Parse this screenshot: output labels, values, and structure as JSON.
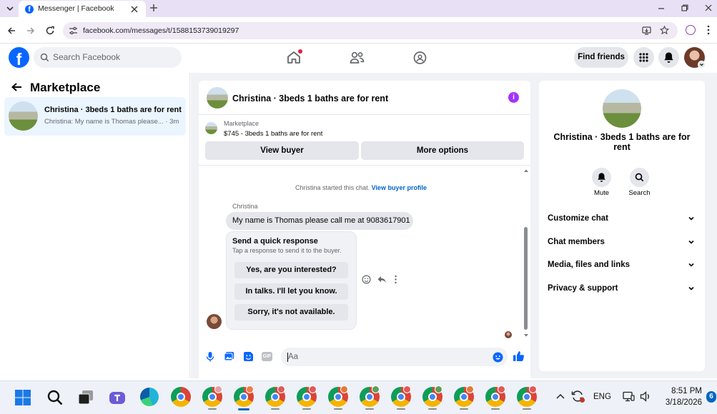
{
  "browser": {
    "tab_title": "Messenger | Facebook",
    "url": "facebook.com/messages/t/1588153739019297"
  },
  "fb_header": {
    "search_placeholder": "Search Facebook",
    "find_friends": "Find friends"
  },
  "left": {
    "title": "Marketplace",
    "conversation": {
      "title": "Christina · 3beds 1 baths are for rent",
      "preview": "Christina: My name is Thomas please... · 3m"
    }
  },
  "chat": {
    "header_title": "Christina · 3beds 1 baths are for rent",
    "listing_source": "Marketplace",
    "listing_line": "$745 - 3beds 1 baths are for rent",
    "view_buyer": "View buyer",
    "more_options": "More options",
    "started_text": "Christina started this chat.",
    "view_buyer_profile": "View buyer profile",
    "sender_name": "Christina",
    "message": "My name is Thomas please call me at 9083617901",
    "quick_title": "Send a quick response",
    "quick_sub": "Tap a response to send it to the buyer.",
    "quick_responses": [
      "Yes, are you interested?",
      "In talks. I'll let you know.",
      "Sorry, it's not available."
    ],
    "composer_placeholder": "Aa"
  },
  "info": {
    "title": "Christina · 3beds 1 baths are for rent",
    "mute": "Mute",
    "search": "Search",
    "sections": [
      "Customize chat",
      "Chat members",
      "Media, files and links",
      "Privacy & support"
    ]
  },
  "taskbar": {
    "lang": "ENG",
    "time": "8:51 PM",
    "date": "3/18/2026",
    "notif_count": "6"
  },
  "colors": {
    "fb_blue": "#0866ff",
    "messenger_purple": "#a033ff",
    "selected_bg": "#ebf5ff"
  }
}
